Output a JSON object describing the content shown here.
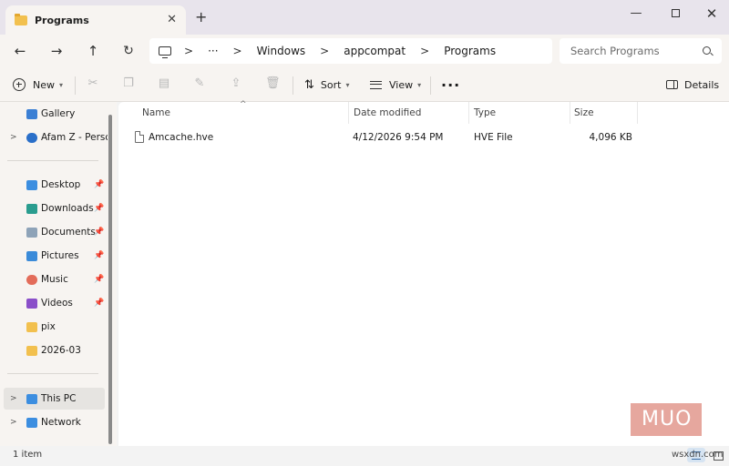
{
  "window": {
    "tab_title": "Programs",
    "tab_close": "✕",
    "new_tab": "+",
    "minimize": "—",
    "close": "✕"
  },
  "nav": {
    "back": "←",
    "forward": "→",
    "up": "↑",
    "refresh": "↻"
  },
  "address": {
    "overflow": "···",
    "separator": ">",
    "crumbs": [
      "Windows",
      "appcompat",
      "Programs"
    ]
  },
  "search": {
    "placeholder": "Search Programs"
  },
  "toolbar": {
    "new_label": "New",
    "sort_label": "Sort",
    "view_label": "View",
    "more_label": "···",
    "details_label": "Details",
    "disabled_icons": [
      "cut-icon",
      "copy-icon",
      "paste-icon",
      "rename-icon",
      "share-icon",
      "delete-icon"
    ]
  },
  "sidebar": {
    "items": [
      {
        "label": "Gallery",
        "icon": "gallery-icon",
        "color": "#3b7fd4",
        "expandable": false,
        "pinned": false
      },
      {
        "label": "Afam Z - Person",
        "icon": "onedrive-icon",
        "color": "#2a6fc9",
        "expandable": true,
        "pinned": false
      },
      {
        "label": "Desktop",
        "icon": "desktop-icon",
        "color": "#3c8ee0",
        "expandable": false,
        "pinned": true
      },
      {
        "label": "Downloads",
        "icon": "downloads-icon",
        "color": "#2a9d8f",
        "expandable": false,
        "pinned": true
      },
      {
        "label": "Documents",
        "icon": "documents-icon",
        "color": "#8ea3b8",
        "expandable": false,
        "pinned": true
      },
      {
        "label": "Pictures",
        "icon": "pictures-icon",
        "color": "#3b8bd9",
        "expandable": false,
        "pinned": true
      },
      {
        "label": "Music",
        "icon": "music-icon",
        "color": "#e36c5a",
        "expandable": false,
        "pinned": true
      },
      {
        "label": "Videos",
        "icon": "videos-icon",
        "color": "#8a4fc9",
        "expandable": false,
        "pinned": true
      },
      {
        "label": "pix",
        "icon": "folder-icon",
        "color": "#f2c04e",
        "expandable": false,
        "pinned": false
      },
      {
        "label": "2026-03",
        "icon": "folder-icon",
        "color": "#f2c04e",
        "expandable": false,
        "pinned": false
      },
      {
        "label": "This PC",
        "icon": "this-pc-icon",
        "color": "#3c8ee0",
        "expandable": true,
        "pinned": false,
        "selected": true
      },
      {
        "label": "Network",
        "icon": "network-icon",
        "color": "#3c8ee0",
        "expandable": true,
        "pinned": false
      }
    ],
    "pin_glyph": "📌",
    "arrow_glyph": ">"
  },
  "columns": [
    "Name",
    "Date modified",
    "Type",
    "Size"
  ],
  "sort_caret": "^",
  "files": [
    {
      "name": "Amcache.hve",
      "date_modified": "4/12/2026 9:54 PM",
      "type": "HVE File",
      "size": "4,096 KB"
    }
  ],
  "status": {
    "item_count": "1 item"
  },
  "watermarks": {
    "brand": "MUO",
    "site": "wsxdn.com"
  }
}
